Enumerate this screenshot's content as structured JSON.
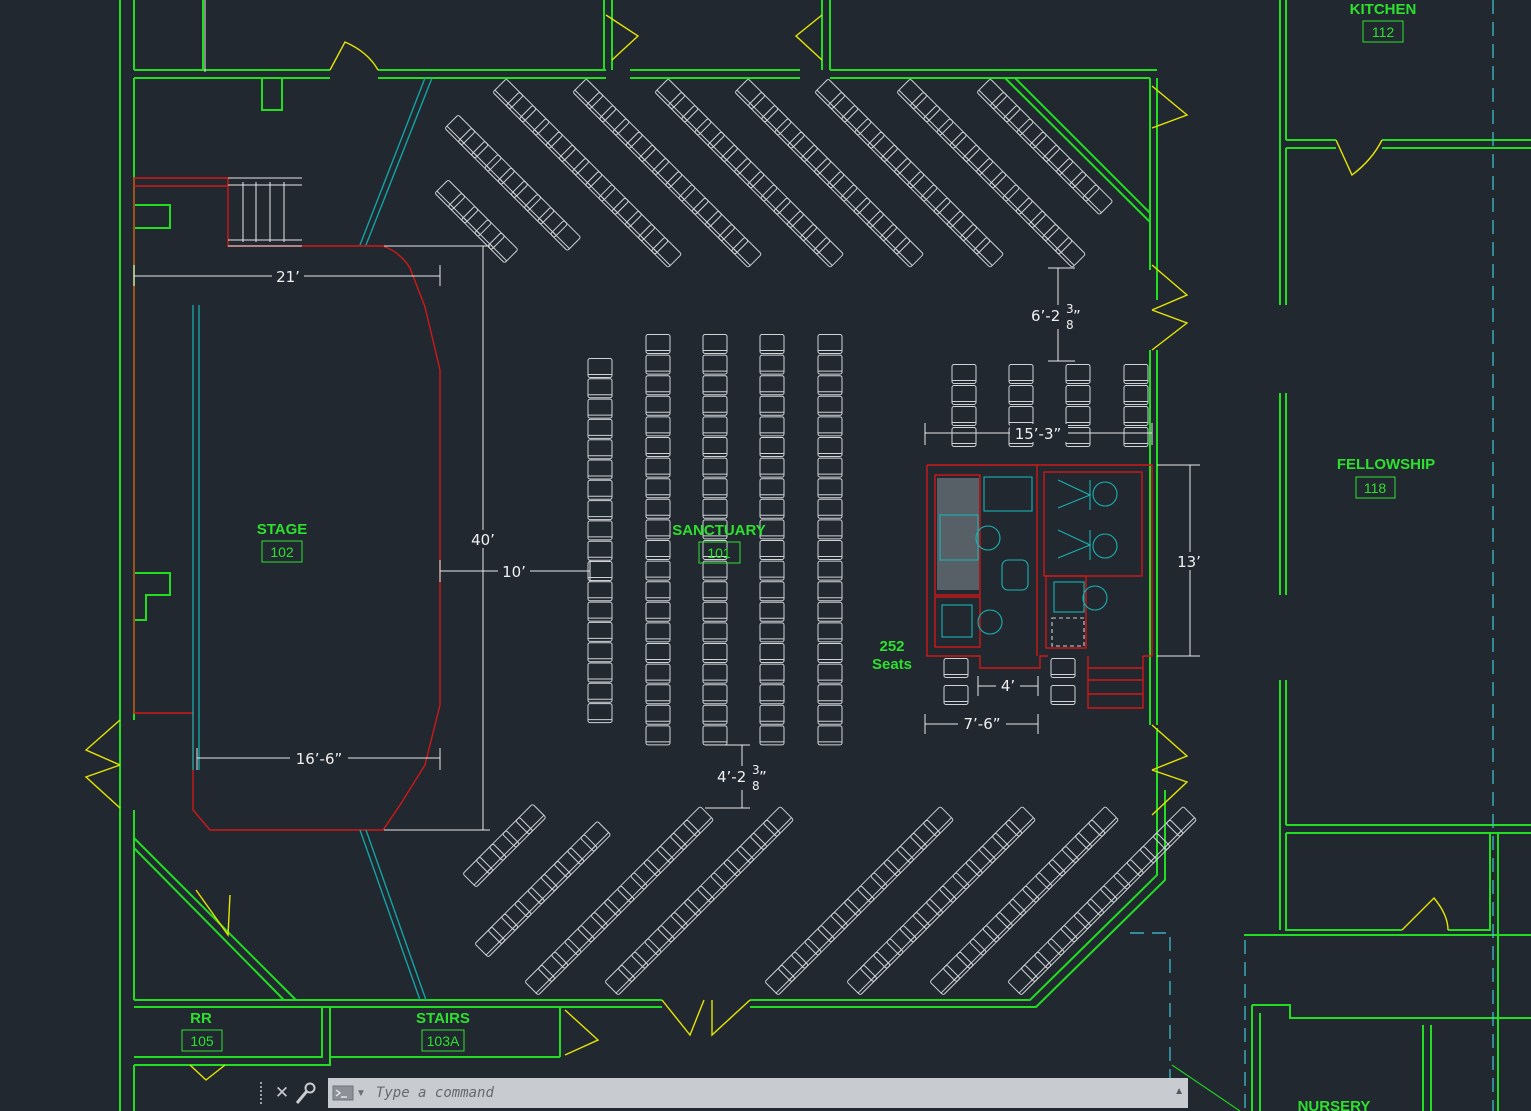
{
  "rooms": {
    "kitchen": {
      "name": "KITCHEN",
      "number": "112"
    },
    "fellowship": {
      "name": "FELLOWSHIP",
      "number": "118"
    },
    "stage": {
      "name": "STAGE",
      "number": "102"
    },
    "sanctuary": {
      "name": "SANCTUARY",
      "number": "101"
    },
    "rr": {
      "name": "RR",
      "number": "105"
    },
    "stairs": {
      "name": "STAIRS",
      "number": "103A"
    },
    "nursery": {
      "name": "NURSERY"
    }
  },
  "seat_count": {
    "line1": "252",
    "line2": "Seats"
  },
  "dimensions": {
    "stage_width": "21’",
    "stage_depth": "40’",
    "stage_to_seats": "10’",
    "stage_inner": "16’-6”",
    "aisle_top_a": "6’-2",
    "aisle_top_frac_num": "3",
    "aisle_top_frac_den": "8",
    "aisle_top_b": "”",
    "booth_width": "15’-3”",
    "booth_depth": "13’",
    "aisle_bottom_a": "4’-2",
    "aisle_bottom_frac_num": "3",
    "aisle_bottom_frac_den": "8",
    "aisle_bottom_b": "”",
    "booth_step": "4’",
    "booth_seat_block": "7’-6”"
  },
  "colors": {
    "background": "#212830",
    "walls": "#22dd22",
    "doors": "#e6e600",
    "stage_outline": "#d01818",
    "equipment": "#1ab2b2",
    "dimensions": "#e8e8e8",
    "command_bar": "#c8cbd0"
  },
  "command_line": {
    "placeholder": "Type a command",
    "close_icon": "close-icon",
    "settings_icon": "wrench-icon",
    "prompt_icon": "command-prompt-icon"
  }
}
